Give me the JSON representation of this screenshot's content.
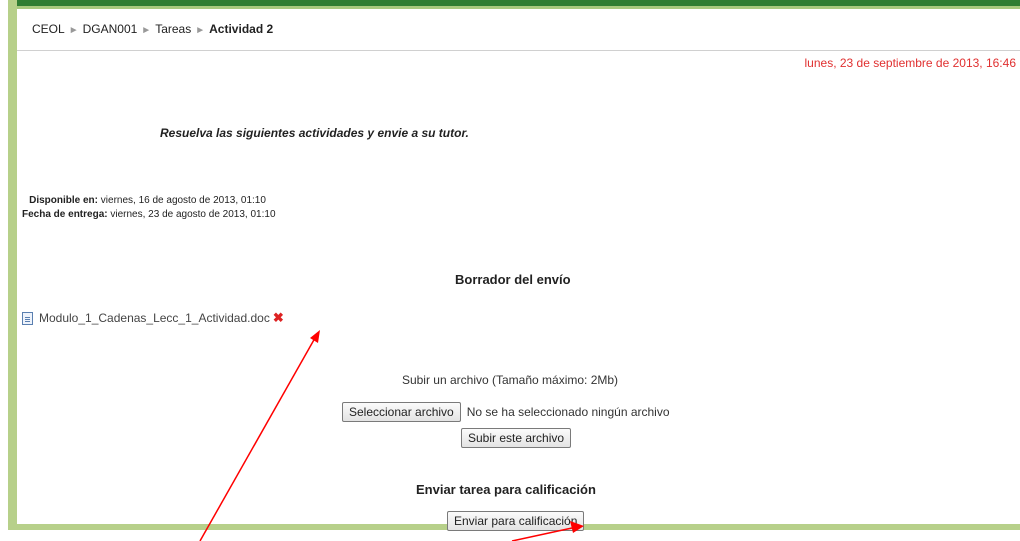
{
  "breadcrumb": {
    "items": [
      "CEOL",
      "DGAN001",
      "Tareas"
    ],
    "current": "Actividad 2",
    "separator": "►"
  },
  "header": {
    "current_date": "lunes, 23 de septiembre de 2013, 16:46"
  },
  "assignment": {
    "intro": "Resuelva las siguientes actividades y envie a su tutor.",
    "available_label": "Disponible en:",
    "available_value": "viernes, 16 de agosto de 2013, 01:10",
    "due_label": "Fecha de entrega:",
    "due_value": "viernes, 23 de agosto de 2013, 01:10"
  },
  "draft": {
    "heading": "Borrador del envío",
    "file_name": "Modulo_1_Cadenas_Lecc_1_Actividad.doc",
    "file_icon": "doc-icon",
    "delete_icon": "delete-x-icon"
  },
  "upload": {
    "label": "Subir un archivo (Tamaño máximo: 2Mb)",
    "select_button": "Seleccionar archivo",
    "no_file_text": "No se ha seleccionado ningún archivo",
    "upload_button": "Subir este archivo"
  },
  "submit": {
    "heading": "Enviar tarea para calificación",
    "button": "Enviar para calificación"
  },
  "colors": {
    "frame_green": "#2f7d32",
    "frame_light": "#b7d08a",
    "date_red": "#e03030",
    "annotation_red": "#ff0000",
    "delete_red": "#d22222"
  }
}
